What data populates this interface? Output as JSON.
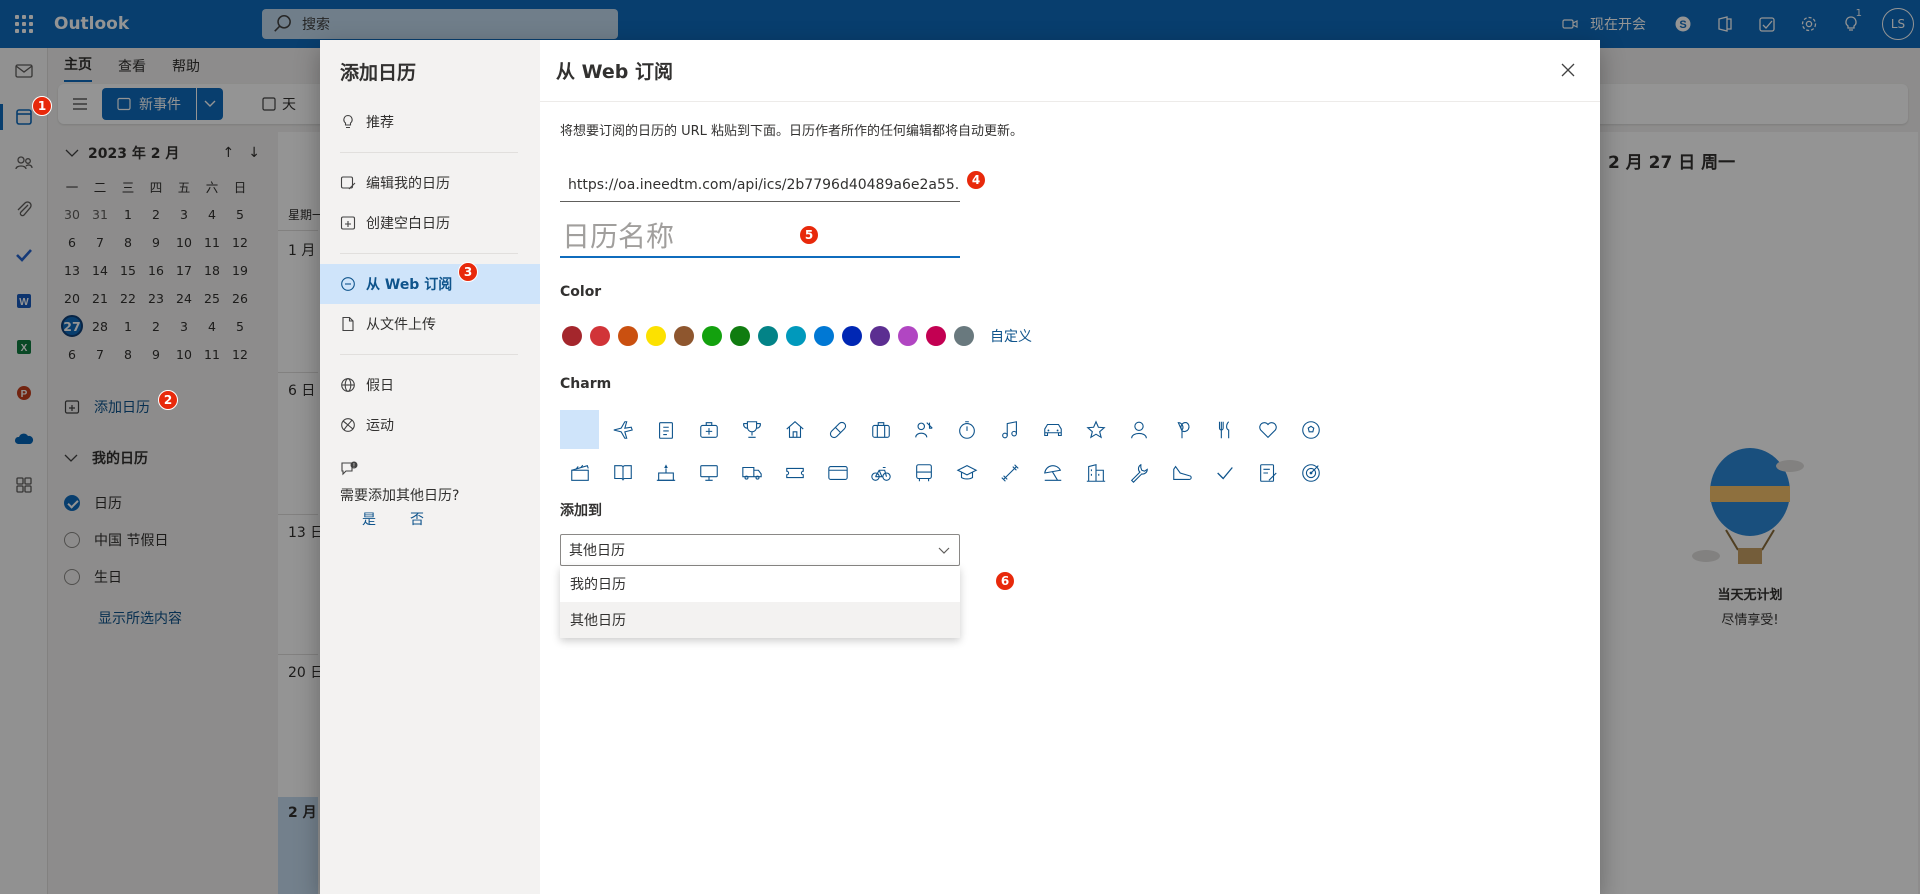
{
  "app": {
    "title": "Outlook"
  },
  "search": {
    "placeholder": "搜索"
  },
  "topbar": {
    "meet_now": "现在开会",
    "tips_count": "1",
    "avatar_initials": "LS"
  },
  "ribbon": {
    "tabs": [
      {
        "label": "主页"
      },
      {
        "label": "查看"
      },
      {
        "label": "帮助"
      }
    ],
    "new_event": "新事件",
    "view": "天"
  },
  "mini_calendar": {
    "month_label": "2023 年 2 月",
    "weekdays": [
      "一",
      "二",
      "三",
      "四",
      "五",
      "六",
      "日"
    ],
    "weeks": [
      [
        "30",
        "31",
        "1",
        "2",
        "3",
        "4",
        "5"
      ],
      [
        "6",
        "7",
        "8",
        "9",
        "10",
        "11",
        "12"
      ],
      [
        "13",
        "14",
        "15",
        "16",
        "17",
        "18",
        "19"
      ],
      [
        "20",
        "21",
        "22",
        "23",
        "24",
        "25",
        "26"
      ],
      [
        "27",
        "28",
        "1",
        "2",
        "3",
        "4",
        "5"
      ],
      [
        "6",
        "7",
        "8",
        "9",
        "10",
        "11",
        "12"
      ]
    ],
    "today": "27"
  },
  "left_panel": {
    "add_calendar": "添加日历",
    "my_calendars_title": "我的日历",
    "calendars": [
      {
        "label": "日历",
        "checked": true
      },
      {
        "label": "中国 节假日",
        "checked": false
      },
      {
        "label": "生日",
        "checked": false
      }
    ],
    "show_all": "显示所选内容"
  },
  "calendar_view": {
    "weekday_col": "星期一",
    "week_rows": [
      "1 月",
      "6 日",
      "13 日",
      "20 日",
      "2 月"
    ],
    "right_header": "2 月 27 日 周一",
    "empty_title": "当天无计划",
    "empty_sub": "尽情享受!"
  },
  "dialog": {
    "nav_title": "添加日历",
    "nav_items": [
      {
        "label": "推荐"
      },
      {
        "label": "编辑我的日历"
      },
      {
        "label": "创建空白日历"
      },
      {
        "label": "从 Web 订阅"
      },
      {
        "label": "从文件上传"
      },
      {
        "label": "假日"
      },
      {
        "label": "运动"
      }
    ],
    "feedback_question": "需要添加其他日历?",
    "feedback_yes": "是",
    "feedback_no": "否",
    "title": "从 Web 订阅",
    "description": "将想要订阅的日历的 URL 粘贴到下面。日历作者所作的任何编辑都将自动更新。",
    "url_value": "https://oa.ineedtm.com/api/ics/2b7796d40489a6e2a55...",
    "name_placeholder": "日历名称",
    "color_label": "Color",
    "colors": [
      "#a4262c",
      "#d13438",
      "#ca5010",
      "#fce100",
      "#8e562e",
      "#13a10e",
      "#107c10",
      "#038387",
      "#0099bc",
      "#0078d4",
      "#0027b4",
      "#5c2e91",
      "#b146c2",
      "#c30052",
      "#69797e"
    ],
    "custom_label": "自定义",
    "charm_label": "Charm",
    "charms": [
      "none",
      "airplane",
      "clipboard",
      "medical-kit",
      "trophy",
      "home",
      "pill",
      "briefcase",
      "people",
      "stopwatch",
      "music-note",
      "car",
      "star",
      "person",
      "balloon",
      "fork-knife",
      "heart",
      "soccer-ball",
      "clapperboard",
      "book",
      "cake",
      "monitor",
      "truck",
      "ticket",
      "credit-card",
      "bicycle",
      "bus",
      "graduation-cap",
      "dumbbell",
      "umbrella-beach",
      "building",
      "wrench",
      "shoe",
      "checkmark",
      "notepad",
      "target"
    ],
    "add_to_label": "添加到",
    "add_to_value": "其他日历",
    "options": [
      {
        "label": "我的日历"
      },
      {
        "label": "其他日历"
      }
    ]
  },
  "annotations": [
    "1",
    "2",
    "3",
    "4",
    "5",
    "6"
  ],
  "colors": {
    "accent": "#0f6cbd",
    "badge": "#e8290b",
    "nav_active": "#cfe4fa"
  }
}
